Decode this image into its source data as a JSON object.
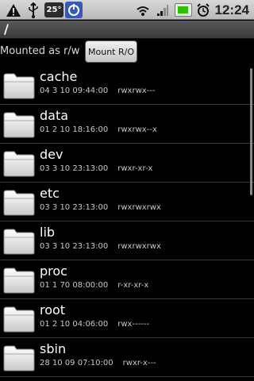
{
  "status_bar": {
    "time": "12:24",
    "temperature": "25°",
    "icons": [
      "warning-icon",
      "usb-icon",
      "temperature-badge",
      "app-notification-icon",
      "wifi-icon",
      "signal-icon",
      "battery-charging-icon",
      "alarm-icon"
    ]
  },
  "path": "/",
  "mount": {
    "label": "Mounted as r/w",
    "button": "Mount R/O"
  },
  "files": [
    {
      "name": "cache",
      "date": "04 3 10 09:44:00",
      "perms": "rwxrwx---"
    },
    {
      "name": "data",
      "date": "01 2 10 18:16:00",
      "perms": "rwxrwx--x"
    },
    {
      "name": "dev",
      "date": "03 3 10 23:13:00",
      "perms": "rwxr-xr-x"
    },
    {
      "name": "etc",
      "date": "03 3 10 23:13:00",
      "perms": "rwxrwxrwx"
    },
    {
      "name": "lib",
      "date": "03 3 10 23:13:00",
      "perms": "rwxrwxrwx"
    },
    {
      "name": "proc",
      "date": "01 1 70 08:00:00",
      "perms": "r-xr-xr-x"
    },
    {
      "name": "root",
      "date": "01 2 10 04:06:00",
      "perms": "rwx------"
    },
    {
      "name": "sbin",
      "date": "28 10 09 07:10:00",
      "perms": "rwxr-x---"
    }
  ],
  "colors": {
    "background": "#000000",
    "statusbar": "#c8c8c8",
    "battery": "#2ec000"
  }
}
